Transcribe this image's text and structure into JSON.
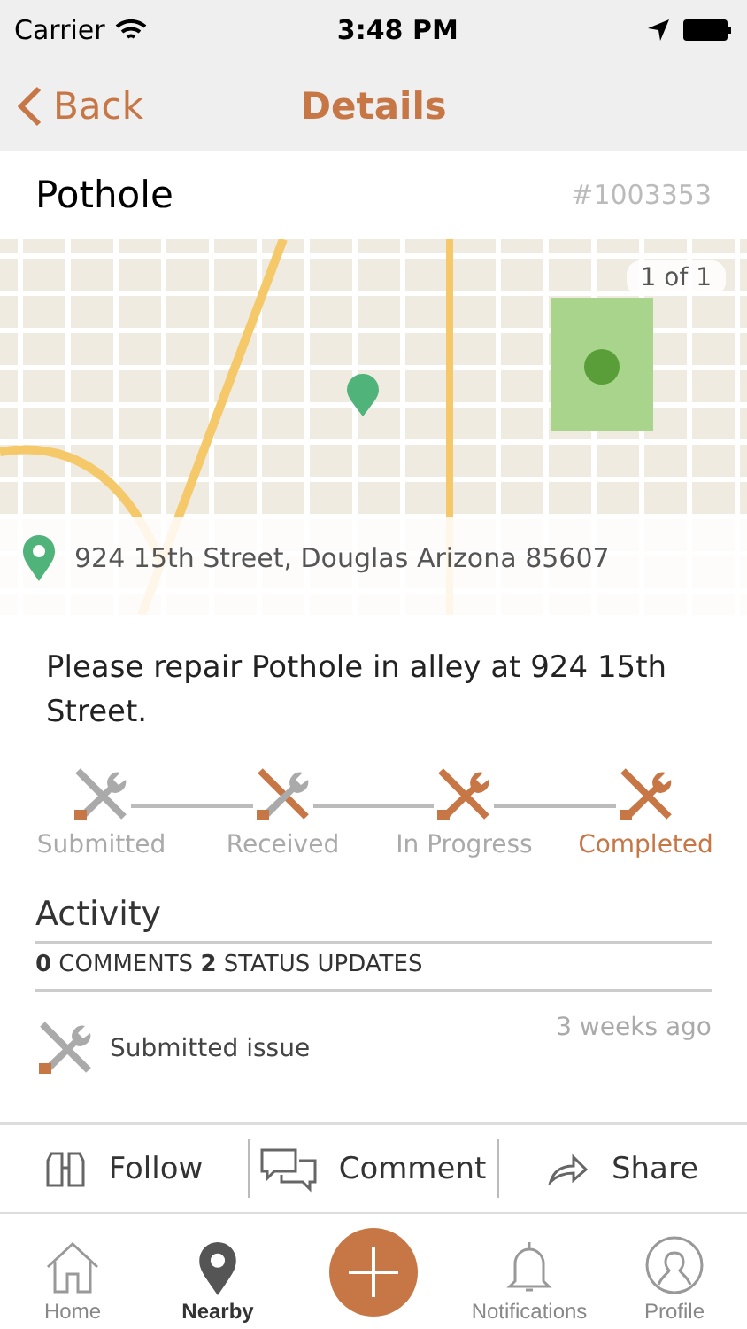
{
  "status_bar": {
    "carrier": "Carrier",
    "time": "3:48 PM"
  },
  "nav": {
    "back": "Back",
    "title": "Details"
  },
  "issue": {
    "title": "Pothole",
    "number": "#1003353"
  },
  "map": {
    "kind": "picture",
    "pager": "1 of 1",
    "address": "924  15th Street, Douglas Arizona 85607"
  },
  "description": "Please repair Pothole in alley at 924 15th Street.",
  "steps": [
    {
      "label": "Submitted",
      "selected": false
    },
    {
      "label": "Received",
      "selected": false
    },
    {
      "label": "In Progress",
      "selected": false
    },
    {
      "label": "Completed",
      "selected": true
    }
  ],
  "activity": {
    "title": "Activity",
    "summary": "**0** COMMENTS **2** STATUS UPDATES",
    "entries": [
      {
        "text": "Submitted issue",
        "time": "3 weeks ago"
      }
    ]
  },
  "actions": [
    {
      "kind": "follow",
      "label": "Follow"
    },
    {
      "kind": "comment",
      "label": "Comment"
    },
    {
      "kind": "share",
      "label": "Share"
    }
  ],
  "tabs": [
    {
      "kind": "home",
      "label": "Home",
      "selected": false
    },
    {
      "kind": "nearby",
      "label": "Nearby",
      "selected": true
    },
    {
      "kind": "add"
    },
    {
      "kind": "bell",
      "label": "Notifications",
      "selected": false
    },
    {
      "kind": "profile",
      "label": "Profile",
      "selected": false
    }
  ]
}
